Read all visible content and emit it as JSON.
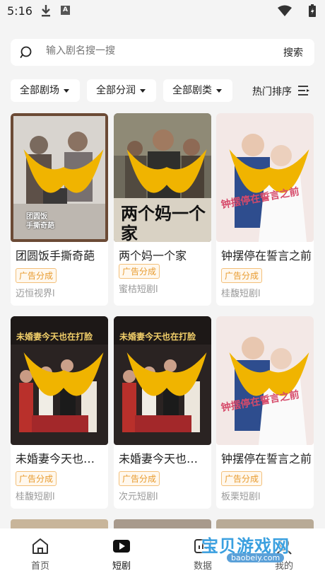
{
  "status": {
    "time": "5:16",
    "a_icon": "A"
  },
  "search": {
    "placeholder": "输入剧名搜一搜",
    "button": "搜索"
  },
  "filters": [
    {
      "label": "全部剧场"
    },
    {
      "label": "全部分润"
    },
    {
      "label": "全部剧类"
    }
  ],
  "sort": {
    "label": "热门排序"
  },
  "cards": [
    {
      "title": "团圆饭手撕奇葩",
      "badge": "广告分成",
      "studio": "迈恒视界l",
      "poster_text": "团圆饭\n手撕奇葩"
    },
    {
      "title": "两个妈一个家",
      "badge": "广告分成",
      "studio": "蜜桔短剧l",
      "poster_text": "两个妈一个家"
    },
    {
      "title": "钟摆停在誓言之前",
      "badge": "广告分成",
      "studio": "桂馥短剧l",
      "poster_text": "钟摆停在誓言之前"
    },
    {
      "title": "未婚妻今天也在打脸",
      "badge": "广告分成",
      "studio": "桂馥短剧l",
      "poster_text": "未婚妻今天也在打脸"
    },
    {
      "title": "未婚妻今天也在打脸",
      "badge": "广告分成",
      "studio": "次元短剧l",
      "poster_text": "未婚妻今天也在打脸"
    },
    {
      "title": "钟摆停在誓言之前",
      "badge": "广告分成",
      "studio": "板栗短剧l",
      "poster_text": "钟摆停在誓言之前"
    }
  ],
  "nav": [
    {
      "label": "首页"
    },
    {
      "label": "短剧"
    },
    {
      "label": "数据"
    },
    {
      "label": "我的"
    }
  ],
  "watermark": {
    "text": "宝贝游戏网",
    "url": "baobeiy.com"
  },
  "colors": {
    "accent": "#e89b2f",
    "background": "#f4f4f4"
  }
}
